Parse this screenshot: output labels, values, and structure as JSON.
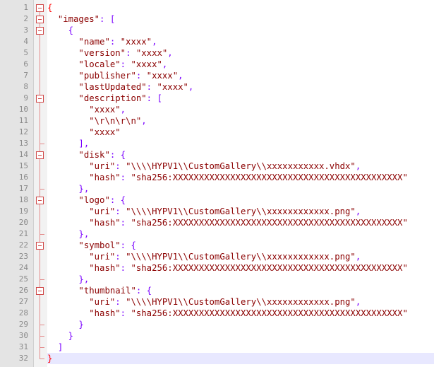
{
  "editor": {
    "lines": [
      {
        "n": "1",
        "fold": "box-top",
        "tokens": [
          {
            "t": "{",
            "c": "tok-op-red"
          }
        ]
      },
      {
        "n": "2",
        "fold": "box",
        "tokens": [
          {
            "t": "  ",
            "c": ""
          },
          {
            "t": "\"images\"",
            "c": "tok-str"
          },
          {
            "t": ": [",
            "c": "tok-op"
          }
        ]
      },
      {
        "n": "3",
        "fold": "box",
        "tokens": [
          {
            "t": "    ",
            "c": ""
          },
          {
            "t": "{",
            "c": "tok-op"
          }
        ]
      },
      {
        "n": "4",
        "fold": "line",
        "tokens": [
          {
            "t": "      ",
            "c": ""
          },
          {
            "t": "\"name\"",
            "c": "tok-str"
          },
          {
            "t": ": ",
            "c": "tok-op"
          },
          {
            "t": "\"xxxx\"",
            "c": "tok-str"
          },
          {
            "t": ",",
            "c": "tok-op"
          }
        ]
      },
      {
        "n": "5",
        "fold": "line",
        "tokens": [
          {
            "t": "      ",
            "c": ""
          },
          {
            "t": "\"version\"",
            "c": "tok-str"
          },
          {
            "t": ": ",
            "c": "tok-op"
          },
          {
            "t": "\"xxxx\"",
            "c": "tok-str"
          },
          {
            "t": ",",
            "c": "tok-op"
          }
        ]
      },
      {
        "n": "6",
        "fold": "line",
        "tokens": [
          {
            "t": "      ",
            "c": ""
          },
          {
            "t": "\"locale\"",
            "c": "tok-str"
          },
          {
            "t": ": ",
            "c": "tok-op"
          },
          {
            "t": "\"xxxx\"",
            "c": "tok-str"
          },
          {
            "t": ",",
            "c": "tok-op"
          }
        ]
      },
      {
        "n": "7",
        "fold": "line",
        "tokens": [
          {
            "t": "      ",
            "c": ""
          },
          {
            "t": "\"publisher\"",
            "c": "tok-str"
          },
          {
            "t": ": ",
            "c": "tok-op"
          },
          {
            "t": "\"xxxx\"",
            "c": "tok-str"
          },
          {
            "t": ",",
            "c": "tok-op"
          }
        ]
      },
      {
        "n": "8",
        "fold": "line",
        "tokens": [
          {
            "t": "      ",
            "c": ""
          },
          {
            "t": "\"lastUpdated\"",
            "c": "tok-str"
          },
          {
            "t": ": ",
            "c": "tok-op"
          },
          {
            "t": "\"xxxx\"",
            "c": "tok-str"
          },
          {
            "t": ",",
            "c": "tok-op"
          }
        ]
      },
      {
        "n": "9",
        "fold": "box",
        "tokens": [
          {
            "t": "      ",
            "c": ""
          },
          {
            "t": "\"description\"",
            "c": "tok-str"
          },
          {
            "t": ": [",
            "c": "tok-op"
          }
        ]
      },
      {
        "n": "10",
        "fold": "line",
        "tokens": [
          {
            "t": "        ",
            "c": ""
          },
          {
            "t": "\"xxxx\"",
            "c": "tok-str"
          },
          {
            "t": ",",
            "c": "tok-op"
          }
        ]
      },
      {
        "n": "11",
        "fold": "line",
        "tokens": [
          {
            "t": "        ",
            "c": ""
          },
          {
            "t": "\"\\r\\n\\r\\n\"",
            "c": "tok-str"
          },
          {
            "t": ",",
            "c": "tok-op"
          }
        ]
      },
      {
        "n": "12",
        "fold": "line",
        "tokens": [
          {
            "t": "        ",
            "c": ""
          },
          {
            "t": "\"xxxx\"",
            "c": "tok-str"
          }
        ]
      },
      {
        "n": "13",
        "fold": "end",
        "tokens": [
          {
            "t": "      ",
            "c": ""
          },
          {
            "t": "],",
            "c": "tok-op"
          }
        ]
      },
      {
        "n": "14",
        "fold": "box",
        "tokens": [
          {
            "t": "      ",
            "c": ""
          },
          {
            "t": "\"disk\"",
            "c": "tok-str"
          },
          {
            "t": ": {",
            "c": "tok-op"
          }
        ]
      },
      {
        "n": "15",
        "fold": "line",
        "tokens": [
          {
            "t": "        ",
            "c": ""
          },
          {
            "t": "\"uri\"",
            "c": "tok-str"
          },
          {
            "t": ": ",
            "c": "tok-op"
          },
          {
            "t": "\"\\\\\\\\HYPV1\\\\CustomGallery\\\\xxxxxxxxxxx.vhdx\"",
            "c": "tok-str"
          },
          {
            "t": ",",
            "c": "tok-op"
          }
        ]
      },
      {
        "n": "16",
        "fold": "line",
        "tokens": [
          {
            "t": "        ",
            "c": ""
          },
          {
            "t": "\"hash\"",
            "c": "tok-str"
          },
          {
            "t": ": ",
            "c": "tok-op"
          },
          {
            "t": "\"sha256:XXXXXXXXXXXXXXXXXXXXXXXXXXXXXXXXXXXXXXXXXXXX\"",
            "c": "tok-str"
          }
        ]
      },
      {
        "n": "17",
        "fold": "end",
        "tokens": [
          {
            "t": "      ",
            "c": ""
          },
          {
            "t": "},",
            "c": "tok-op"
          }
        ]
      },
      {
        "n": "18",
        "fold": "box",
        "tokens": [
          {
            "t": "      ",
            "c": ""
          },
          {
            "t": "\"logo\"",
            "c": "tok-str"
          },
          {
            "t": ": {",
            "c": "tok-op"
          }
        ]
      },
      {
        "n": "19",
        "fold": "line",
        "tokens": [
          {
            "t": "        ",
            "c": ""
          },
          {
            "t": "\"uri\"",
            "c": "tok-str"
          },
          {
            "t": ": ",
            "c": "tok-op"
          },
          {
            "t": "\"\\\\\\\\HYPV1\\\\CustomGallery\\\\xxxxxxxxxxxx.png\"",
            "c": "tok-str"
          },
          {
            "t": ",",
            "c": "tok-op"
          }
        ]
      },
      {
        "n": "20",
        "fold": "line",
        "tokens": [
          {
            "t": "        ",
            "c": ""
          },
          {
            "t": "\"hash\"",
            "c": "tok-str"
          },
          {
            "t": ": ",
            "c": "tok-op"
          },
          {
            "t": "\"sha256:XXXXXXXXXXXXXXXXXXXXXXXXXXXXXXXXXXXXXXXXXXXX\"",
            "c": "tok-str"
          }
        ]
      },
      {
        "n": "21",
        "fold": "end",
        "tokens": [
          {
            "t": "      ",
            "c": ""
          },
          {
            "t": "},",
            "c": "tok-op"
          }
        ]
      },
      {
        "n": "22",
        "fold": "box",
        "tokens": [
          {
            "t": "      ",
            "c": ""
          },
          {
            "t": "\"symbol\"",
            "c": "tok-str"
          },
          {
            "t": ": {",
            "c": "tok-op"
          }
        ]
      },
      {
        "n": "23",
        "fold": "line",
        "tokens": [
          {
            "t": "        ",
            "c": ""
          },
          {
            "t": "\"uri\"",
            "c": "tok-str"
          },
          {
            "t": ": ",
            "c": "tok-op"
          },
          {
            "t": "\"\\\\\\\\HYPV1\\\\CustomGallery\\\\xxxxxxxxxxxx.png\"",
            "c": "tok-str"
          },
          {
            "t": ",",
            "c": "tok-op"
          }
        ]
      },
      {
        "n": "24",
        "fold": "line",
        "tokens": [
          {
            "t": "        ",
            "c": ""
          },
          {
            "t": "\"hash\"",
            "c": "tok-str"
          },
          {
            "t": ": ",
            "c": "tok-op"
          },
          {
            "t": "\"sha256:XXXXXXXXXXXXXXXXXXXXXXXXXXXXXXXXXXXXXXXXXXXX\"",
            "c": "tok-str"
          }
        ]
      },
      {
        "n": "25",
        "fold": "end",
        "tokens": [
          {
            "t": "      ",
            "c": ""
          },
          {
            "t": "},",
            "c": "tok-op"
          }
        ]
      },
      {
        "n": "26",
        "fold": "box",
        "tokens": [
          {
            "t": "      ",
            "c": ""
          },
          {
            "t": "\"thumbnail\"",
            "c": "tok-str"
          },
          {
            "t": ": {",
            "c": "tok-op"
          }
        ]
      },
      {
        "n": "27",
        "fold": "line",
        "tokens": [
          {
            "t": "        ",
            "c": ""
          },
          {
            "t": "\"uri\"",
            "c": "tok-str"
          },
          {
            "t": ": ",
            "c": "tok-op"
          },
          {
            "t": "\"\\\\\\\\HYPV1\\\\CustomGallery\\\\xxxxxxxxxxxx.png\"",
            "c": "tok-str"
          },
          {
            "t": ",",
            "c": "tok-op"
          }
        ]
      },
      {
        "n": "28",
        "fold": "line",
        "tokens": [
          {
            "t": "        ",
            "c": ""
          },
          {
            "t": "\"hash\"",
            "c": "tok-str"
          },
          {
            "t": ": ",
            "c": "tok-op"
          },
          {
            "t": "\"sha256:XXXXXXXXXXXXXXXXXXXXXXXXXXXXXXXXXXXXXXXXXXXX\"",
            "c": "tok-str"
          }
        ]
      },
      {
        "n": "29",
        "fold": "end",
        "tokens": [
          {
            "t": "      ",
            "c": ""
          },
          {
            "t": "}",
            "c": "tok-op"
          }
        ]
      },
      {
        "n": "30",
        "fold": "end",
        "tokens": [
          {
            "t": "    ",
            "c": ""
          },
          {
            "t": "}",
            "c": "tok-op"
          }
        ]
      },
      {
        "n": "31",
        "fold": "end",
        "tokens": [
          {
            "t": "  ",
            "c": ""
          },
          {
            "t": "]",
            "c": "tok-op"
          }
        ]
      },
      {
        "n": "32",
        "fold": "end-last",
        "current": true,
        "tokens": [
          {
            "t": "}",
            "c": "tok-op-red"
          }
        ]
      }
    ]
  }
}
